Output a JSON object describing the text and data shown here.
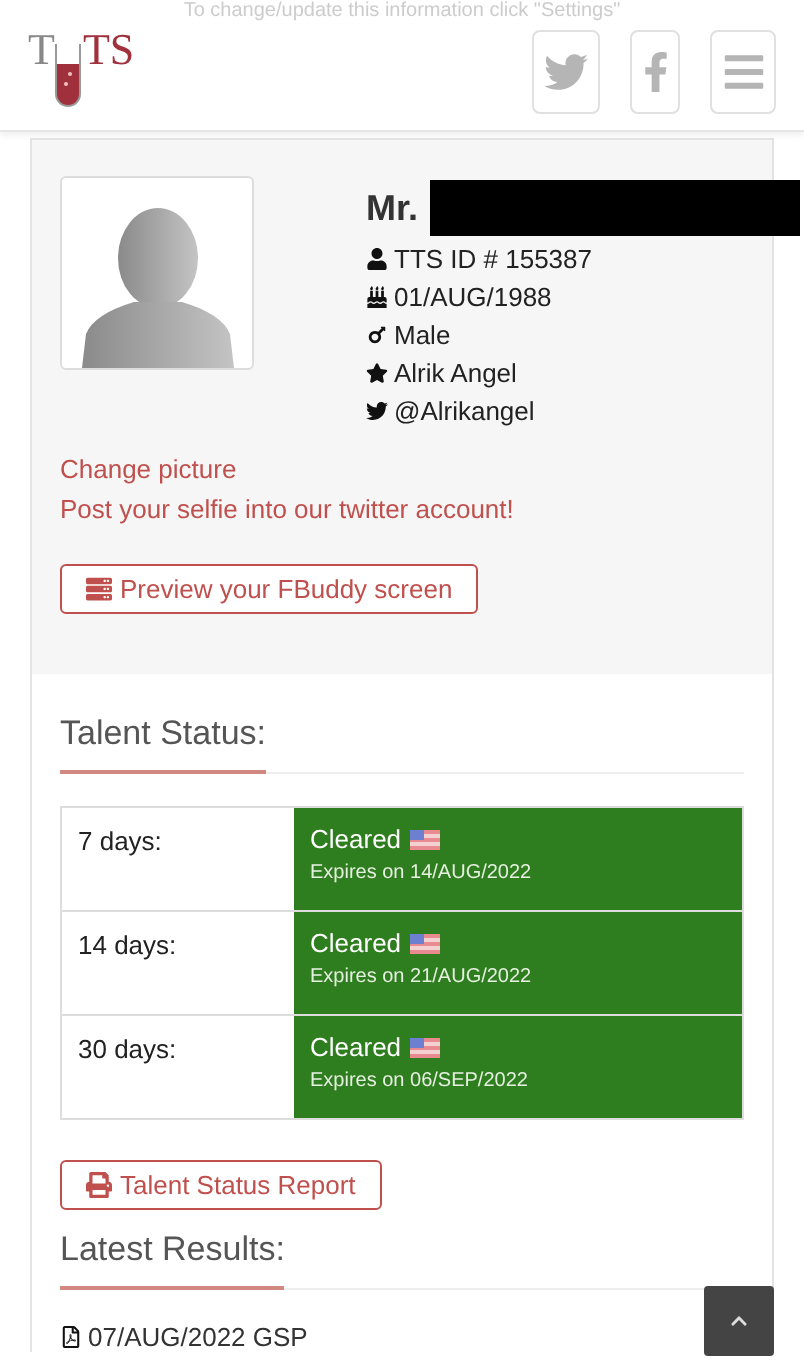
{
  "notice": "To change/update this information click \"Settings\"",
  "logo": {
    "letters": [
      "T",
      "TS"
    ]
  },
  "header_buttons": [
    {
      "kind": "twitter"
    },
    {
      "kind": "facebook"
    },
    {
      "kind": "menu"
    }
  ],
  "profile": {
    "title": "Mr.",
    "details": [
      {
        "kind": "user",
        "text": "TTS ID # 155387"
      },
      {
        "kind": "birthday",
        "text": "01/AUG/1988"
      },
      {
        "kind": "male",
        "text": "Male"
      },
      {
        "kind": "star",
        "text": "Alrik Angel"
      },
      {
        "kind": "twitter",
        "text": "@Alrikangel"
      }
    ],
    "links": [
      "Change picture",
      "Post your selfie into our twitter account!"
    ],
    "preview_button": "Preview your FBuddy screen"
  },
  "talent_status": {
    "heading": "Talent Status:",
    "rows": [
      {
        "period": "7 days:",
        "status": "Cleared",
        "expires": "Expires on 14/AUG/2022",
        "color": "#2e7d1e"
      },
      {
        "period": "14 days:",
        "status": "Cleared",
        "expires": "Expires on 21/AUG/2022",
        "color": "#2e7d1e"
      },
      {
        "period": "30 days:",
        "status": "Cleared",
        "expires": "Expires on 06/SEP/2022",
        "color": "#2e7d1e"
      }
    ],
    "report_button": "Talent Status Report"
  },
  "latest_results": {
    "heading": "Latest Results:",
    "items": [
      "07/AUG/2022 GSP"
    ]
  }
}
